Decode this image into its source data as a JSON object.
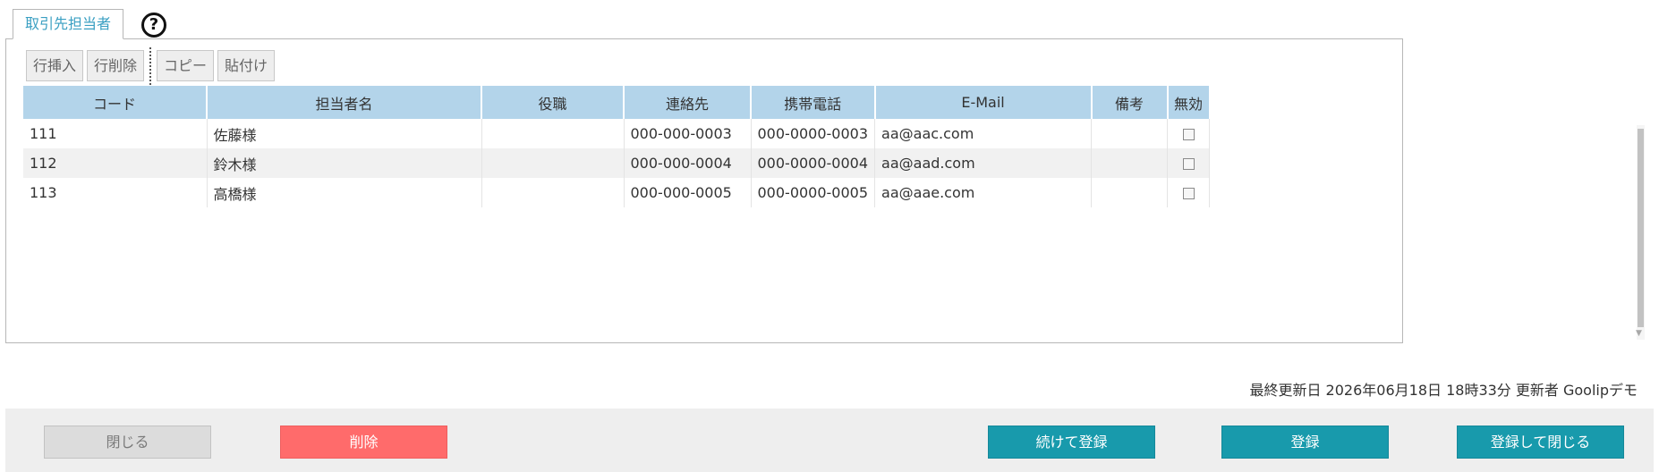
{
  "tab": {
    "label": "取引先担当者"
  },
  "help": {
    "icon": "question-circle-icon",
    "glyph": "?"
  },
  "toolbar": {
    "insert_row": "行挿入",
    "delete_row": "行削除",
    "copy": "コピー",
    "paste": "貼付け"
  },
  "table": {
    "columns": [
      "コード",
      "担当者名",
      "役職",
      "連絡先",
      "携帯電話",
      "E-Mail",
      "備考",
      "無効"
    ],
    "rows": [
      {
        "code": "111",
        "name": "佐藤様",
        "title": "",
        "contact": "000-000-0003",
        "mobile": "000-0000-0003",
        "email": "aa@aac.com",
        "note": "",
        "disabled": false
      },
      {
        "code": "112",
        "name": "鈴木様",
        "title": "",
        "contact": "000-000-0004",
        "mobile": "000-0000-0004",
        "email": "aa@aad.com",
        "note": "",
        "disabled": false
      },
      {
        "code": "113",
        "name": "高橋様",
        "title": "",
        "contact": "000-000-0005",
        "mobile": "000-0000-0005",
        "email": "aa@aae.com",
        "note": "",
        "disabled": false
      }
    ]
  },
  "last_updated": "最終更新日 2026年06月18日 18時33分 更新者 Goolipデモ",
  "footer": {
    "close": "閉じる",
    "delete": "削除",
    "continue_register": "続けて登録",
    "register": "登録",
    "register_and_close": "登録して閉じる"
  },
  "colors": {
    "tab_text": "#3a9fc2",
    "header_bg": "#b3d4ea",
    "delete_button": "#ff6b6b",
    "primary_button": "#189aac"
  }
}
